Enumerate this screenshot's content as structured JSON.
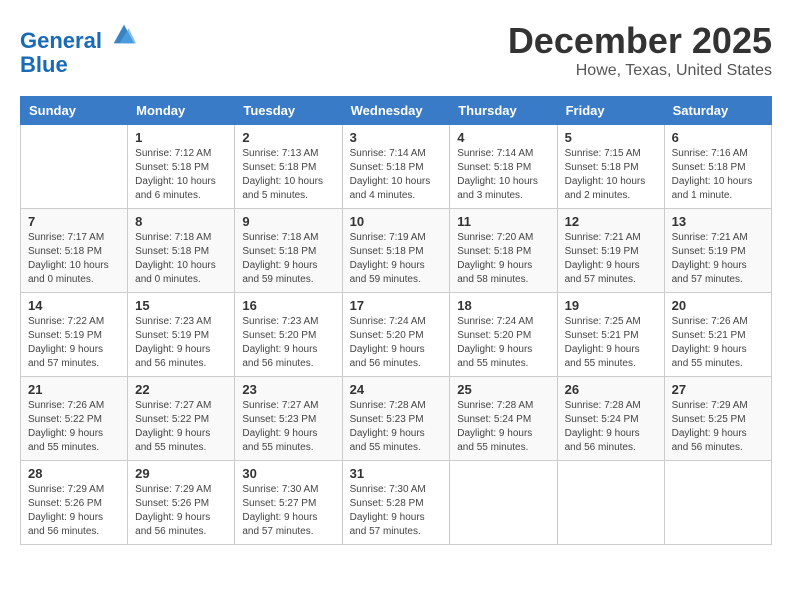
{
  "logo": {
    "line1": "General",
    "line2": "Blue"
  },
  "header": {
    "month": "December 2025",
    "location": "Howe, Texas, United States"
  },
  "weekdays": [
    "Sunday",
    "Monday",
    "Tuesday",
    "Wednesday",
    "Thursday",
    "Friday",
    "Saturday"
  ],
  "weeks": [
    [
      {
        "day": "",
        "info": ""
      },
      {
        "day": "1",
        "info": "Sunrise: 7:12 AM\nSunset: 5:18 PM\nDaylight: 10 hours\nand 6 minutes."
      },
      {
        "day": "2",
        "info": "Sunrise: 7:13 AM\nSunset: 5:18 PM\nDaylight: 10 hours\nand 5 minutes."
      },
      {
        "day": "3",
        "info": "Sunrise: 7:14 AM\nSunset: 5:18 PM\nDaylight: 10 hours\nand 4 minutes."
      },
      {
        "day": "4",
        "info": "Sunrise: 7:14 AM\nSunset: 5:18 PM\nDaylight: 10 hours\nand 3 minutes."
      },
      {
        "day": "5",
        "info": "Sunrise: 7:15 AM\nSunset: 5:18 PM\nDaylight: 10 hours\nand 2 minutes."
      },
      {
        "day": "6",
        "info": "Sunrise: 7:16 AM\nSunset: 5:18 PM\nDaylight: 10 hours\nand 1 minute."
      }
    ],
    [
      {
        "day": "7",
        "info": "Sunrise: 7:17 AM\nSunset: 5:18 PM\nDaylight: 10 hours\nand 0 minutes."
      },
      {
        "day": "8",
        "info": "Sunrise: 7:18 AM\nSunset: 5:18 PM\nDaylight: 10 hours\nand 0 minutes."
      },
      {
        "day": "9",
        "info": "Sunrise: 7:18 AM\nSunset: 5:18 PM\nDaylight: 9 hours\nand 59 minutes."
      },
      {
        "day": "10",
        "info": "Sunrise: 7:19 AM\nSunset: 5:18 PM\nDaylight: 9 hours\nand 59 minutes."
      },
      {
        "day": "11",
        "info": "Sunrise: 7:20 AM\nSunset: 5:18 PM\nDaylight: 9 hours\nand 58 minutes."
      },
      {
        "day": "12",
        "info": "Sunrise: 7:21 AM\nSunset: 5:19 PM\nDaylight: 9 hours\nand 57 minutes."
      },
      {
        "day": "13",
        "info": "Sunrise: 7:21 AM\nSunset: 5:19 PM\nDaylight: 9 hours\nand 57 minutes."
      }
    ],
    [
      {
        "day": "14",
        "info": "Sunrise: 7:22 AM\nSunset: 5:19 PM\nDaylight: 9 hours\nand 57 minutes."
      },
      {
        "day": "15",
        "info": "Sunrise: 7:23 AM\nSunset: 5:19 PM\nDaylight: 9 hours\nand 56 minutes."
      },
      {
        "day": "16",
        "info": "Sunrise: 7:23 AM\nSunset: 5:20 PM\nDaylight: 9 hours\nand 56 minutes."
      },
      {
        "day": "17",
        "info": "Sunrise: 7:24 AM\nSunset: 5:20 PM\nDaylight: 9 hours\nand 56 minutes."
      },
      {
        "day": "18",
        "info": "Sunrise: 7:24 AM\nSunset: 5:20 PM\nDaylight: 9 hours\nand 55 minutes."
      },
      {
        "day": "19",
        "info": "Sunrise: 7:25 AM\nSunset: 5:21 PM\nDaylight: 9 hours\nand 55 minutes."
      },
      {
        "day": "20",
        "info": "Sunrise: 7:26 AM\nSunset: 5:21 PM\nDaylight: 9 hours\nand 55 minutes."
      }
    ],
    [
      {
        "day": "21",
        "info": "Sunrise: 7:26 AM\nSunset: 5:22 PM\nDaylight: 9 hours\nand 55 minutes."
      },
      {
        "day": "22",
        "info": "Sunrise: 7:27 AM\nSunset: 5:22 PM\nDaylight: 9 hours\nand 55 minutes."
      },
      {
        "day": "23",
        "info": "Sunrise: 7:27 AM\nSunset: 5:23 PM\nDaylight: 9 hours\nand 55 minutes."
      },
      {
        "day": "24",
        "info": "Sunrise: 7:28 AM\nSunset: 5:23 PM\nDaylight: 9 hours\nand 55 minutes."
      },
      {
        "day": "25",
        "info": "Sunrise: 7:28 AM\nSunset: 5:24 PM\nDaylight: 9 hours\nand 55 minutes."
      },
      {
        "day": "26",
        "info": "Sunrise: 7:28 AM\nSunset: 5:24 PM\nDaylight: 9 hours\nand 56 minutes."
      },
      {
        "day": "27",
        "info": "Sunrise: 7:29 AM\nSunset: 5:25 PM\nDaylight: 9 hours\nand 56 minutes."
      }
    ],
    [
      {
        "day": "28",
        "info": "Sunrise: 7:29 AM\nSunset: 5:26 PM\nDaylight: 9 hours\nand 56 minutes."
      },
      {
        "day": "29",
        "info": "Sunrise: 7:29 AM\nSunset: 5:26 PM\nDaylight: 9 hours\nand 56 minutes."
      },
      {
        "day": "30",
        "info": "Sunrise: 7:30 AM\nSunset: 5:27 PM\nDaylight: 9 hours\nand 57 minutes."
      },
      {
        "day": "31",
        "info": "Sunrise: 7:30 AM\nSunset: 5:28 PM\nDaylight: 9 hours\nand 57 minutes."
      },
      {
        "day": "",
        "info": ""
      },
      {
        "day": "",
        "info": ""
      },
      {
        "day": "",
        "info": ""
      }
    ]
  ]
}
